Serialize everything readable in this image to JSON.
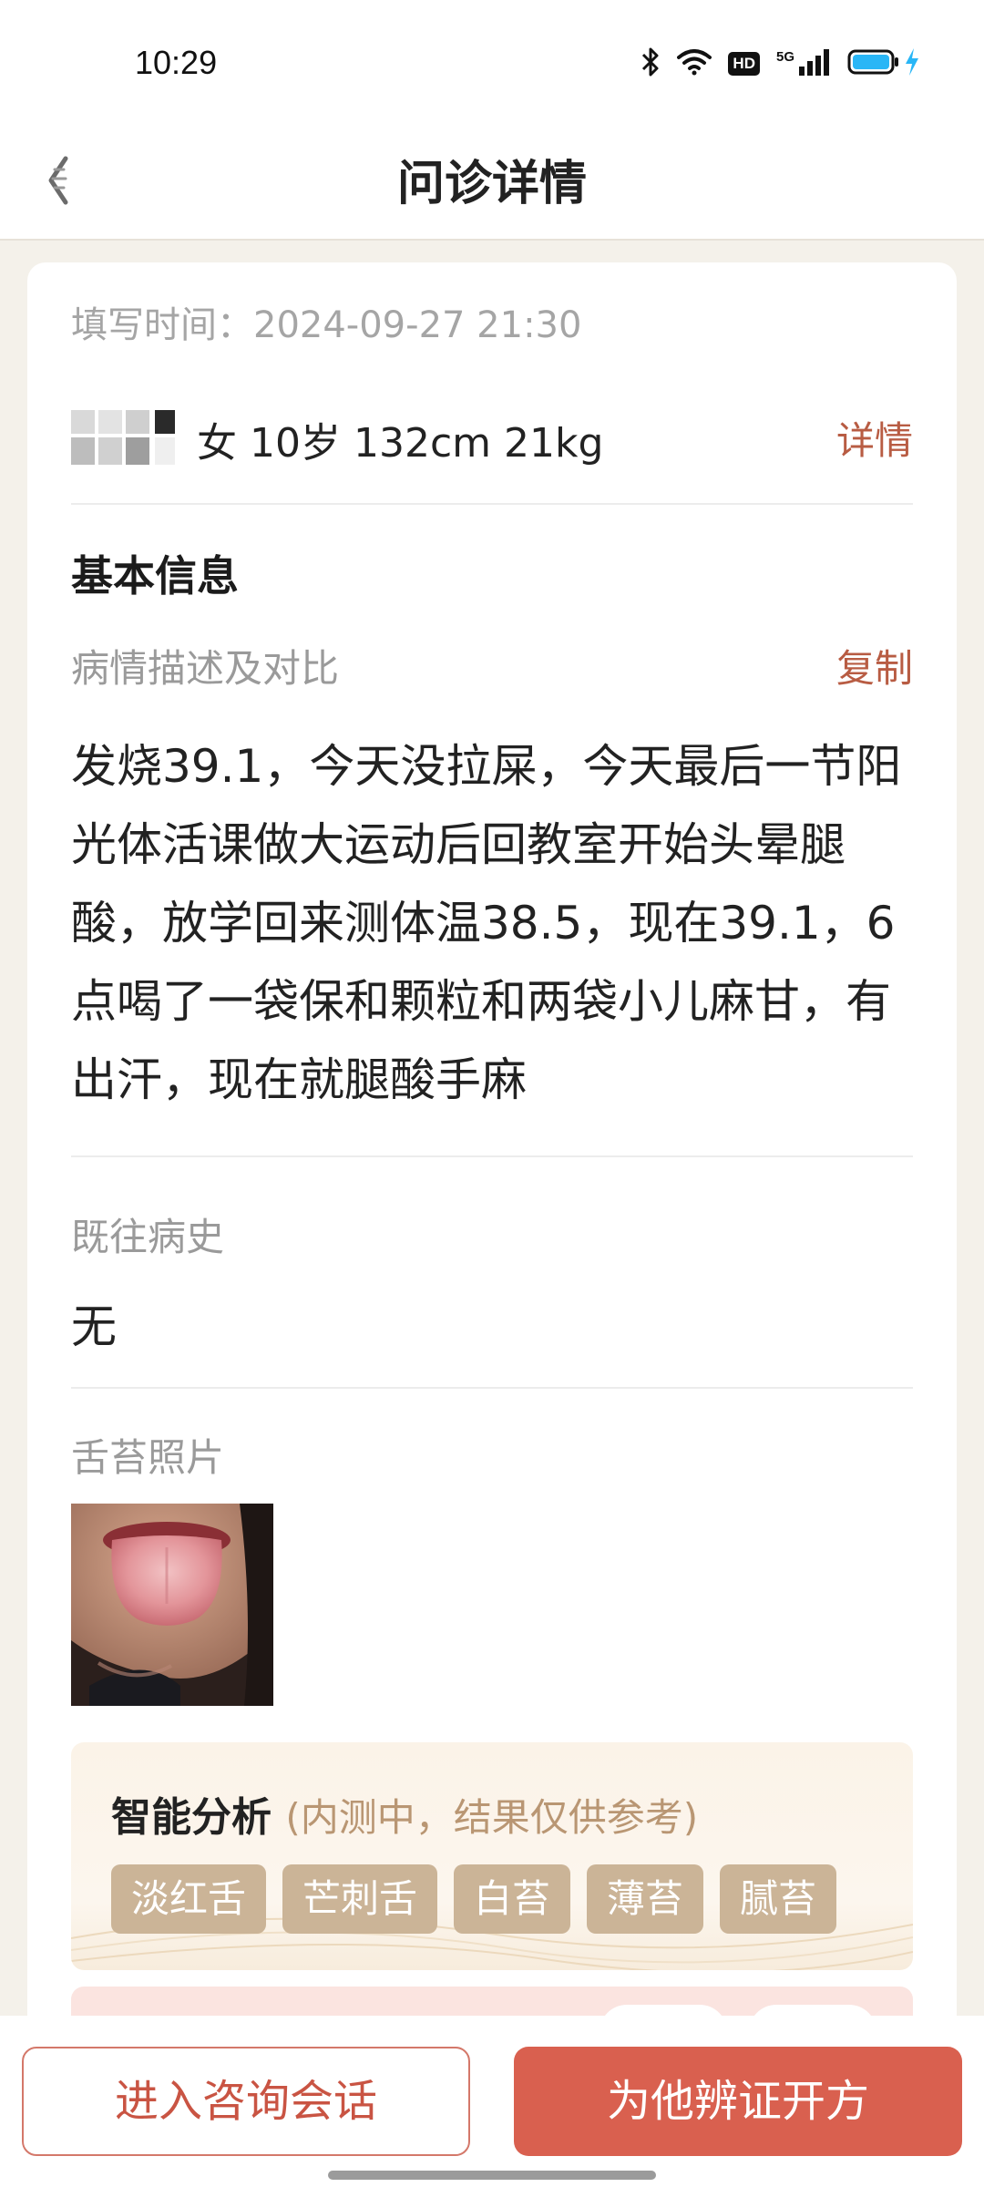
{
  "status_bar": {
    "time": "10:29",
    "hd_badge": "HD",
    "network": "5G",
    "icons": [
      "bluetooth-icon",
      "wifi-icon",
      "hd-icon",
      "signal-icon",
      "battery-icon",
      "charging-icon"
    ]
  },
  "header": {
    "title": "问诊详情",
    "back_icon": "back-arrow-icon"
  },
  "record": {
    "fill_time_label": "填写时间：",
    "fill_time_value": "2024-09-27 21:30",
    "patient_info": "女 10岁 132cm 21kg",
    "detail_link": "详情"
  },
  "basic_info": {
    "title": "基本信息",
    "desc_label": "病情描述及对比",
    "copy_label": "复制",
    "desc_text": "发烧39.1，今天没拉屎，今天最后一节阳光体活课做大运动后回教室开始头晕腿酸，放学回来测体温38.5，现在39.1，6点喝了一袋保和颗粒和两袋小儿麻甘，有出汗，现在就腿酸手麻",
    "history_label": "既往病史",
    "history_value": "无",
    "tongue_label": "舌苔照片"
  },
  "analysis": {
    "title": "智能分析",
    "note": "(内测中，结果仅供参考)",
    "tags": [
      "淡红舌",
      "芒刺舌",
      "白苔",
      "薄苔",
      "腻苔"
    ]
  },
  "actions": {
    "consult_label": "进入咨询会话",
    "prescribe_label": "为他辨证开方"
  },
  "colors": {
    "accent": "#b85c43",
    "primary_button": "#d9604f",
    "tag_bg": "#cbb497",
    "page_bg": "#f4f1ea"
  }
}
